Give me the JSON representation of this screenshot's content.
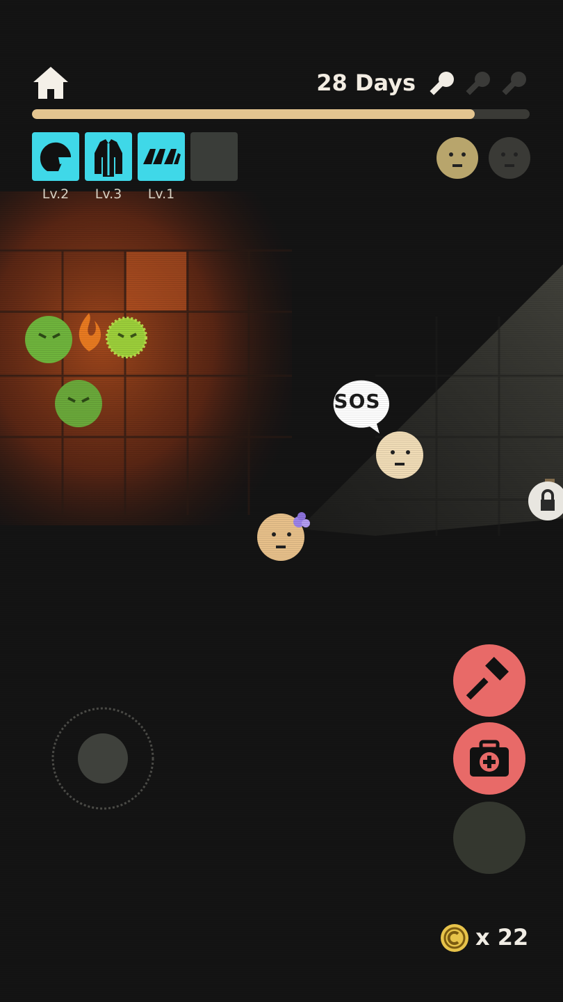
{
  "hud": {
    "home_icon": "home-icon",
    "days_label": "28 Days",
    "keys_collected": 1,
    "keys_total": 3,
    "day_progress": 0.89
  },
  "equipment": [
    {
      "icon": "helmet-icon",
      "level": "Lv.2"
    },
    {
      "icon": "jacket-icon",
      "level": "Lv.3"
    },
    {
      "icon": "gloves-icon",
      "level": "Lv.1"
    },
    {
      "icon": "empty-slot",
      "level": ""
    }
  ],
  "survivors": {
    "rescued": 1,
    "total": 2
  },
  "world": {
    "speech_bubble": "SOS",
    "locked_door_icon": "lock-icon"
  },
  "actions": {
    "build_icon": "hammer-icon",
    "heal_icon": "medkit-icon"
  },
  "inventory": {
    "coin_icon": "coin-icon",
    "coin_count": "x 22"
  },
  "colors": {
    "accent_cyan": "#3fd8e8",
    "action_red": "#e86a68",
    "progress": "#e4c590",
    "zombie_green": "#6fb43c",
    "fire_orange": "#e87a20"
  }
}
